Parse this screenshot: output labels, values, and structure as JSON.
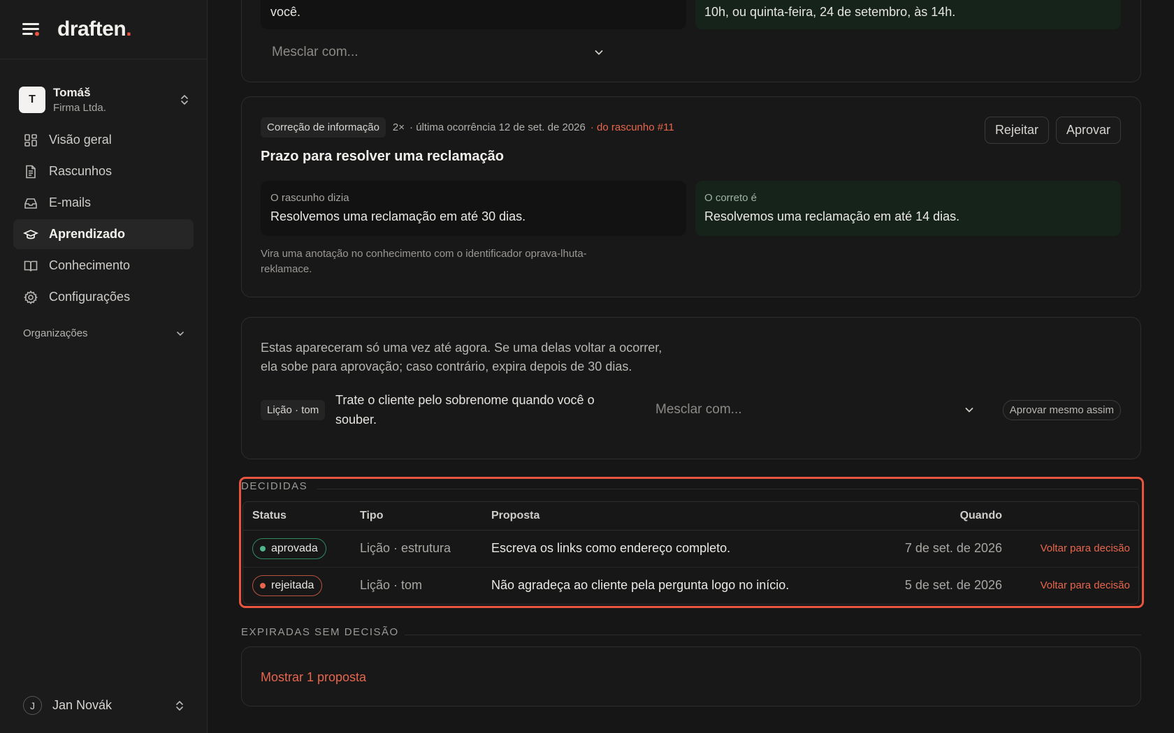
{
  "app": {
    "logo_text": "draften",
    "logo_dot": "."
  },
  "account": {
    "initial": "T",
    "name": "Tomáš",
    "company": "Firma Ltda."
  },
  "sidebar": {
    "items": [
      {
        "label": "Visão geral",
        "icon": "grid-icon"
      },
      {
        "label": "Rascunhos",
        "icon": "document-icon"
      },
      {
        "label": "E-mails",
        "icon": "inbox-icon"
      },
      {
        "label": "Aprendizado",
        "icon": "graduation-cap-icon",
        "active": true
      },
      {
        "label": "Conhecimento",
        "icon": "book-icon"
      },
      {
        "label": "Configurações",
        "icon": "gear-icon"
      }
    ],
    "organizations_label": "Organizações"
  },
  "user": {
    "initial": "J",
    "name": "Jan Novák"
  },
  "top_card": {
    "left_text": "você.",
    "right_text": "10h, ou quinta-feira, 24 de setembro, às 14h.",
    "merge_placeholder": "Mesclar com..."
  },
  "proposal_card": {
    "tag": "Correção de informação",
    "count": "2×",
    "last_occurrence": "· última ocorrência 12 de set. de 2026",
    "source": "· do rascunho #11",
    "title": "Prazo para resolver uma reclamação",
    "reject_label": "Rejeitar",
    "approve_label": "Aprovar",
    "draft_said_label": "O rascunho dizia",
    "draft_said_text": "Resolvemos uma reclamação em até 30 dias.",
    "correct_label": "O correto é",
    "correct_text": "Resolvemos uma reclamação em até 14 dias.",
    "note_line1": "Vira uma anotação no conhecimento com o identificador oprava-lhuta-",
    "note_line2": "reklamace."
  },
  "single_card": {
    "intro_line1": "Estas apareceram só uma vez até agora. Se uma delas voltar a ocorrer,",
    "intro_line2": "ela sobe para aprovação; caso contrário, expira depois de 30 dias.",
    "tag": "Lição · tom",
    "text_line1": "Trate o cliente pelo sobrenome quando você o",
    "text_line2": "souber.",
    "merge_placeholder": "Mesclar com...",
    "approve_anyway_label": "Aprovar mesmo assim"
  },
  "decided": {
    "label": "DECIDIDAS",
    "columns": [
      "Status",
      "Tipo",
      "Proposta",
      "Quando"
    ],
    "rows": [
      {
        "status": "aprovada",
        "status_color": "#4fb58a",
        "type": "Lição · estrutura",
        "proposal": "Escreva os links como endereço completo.",
        "when": "7 de set. de 2026",
        "action": "Voltar para decisão"
      },
      {
        "status": "rejeitada",
        "status_color": "#e8664d",
        "type": "Lição · tom",
        "proposal": "Não agradeça ao cliente pela pergunta logo no início.",
        "when": "5 de set. de 2026",
        "action": "Voltar para decisão"
      }
    ],
    "highlight_color": "#e8553f"
  },
  "expired": {
    "label": "EXPIRADAS SEM DECISÃO",
    "show_label": "Mostrar 1 proposta"
  },
  "colors": {
    "accent": "#e8664d",
    "background": "#161616",
    "sidebar": "#1b1b1b"
  }
}
